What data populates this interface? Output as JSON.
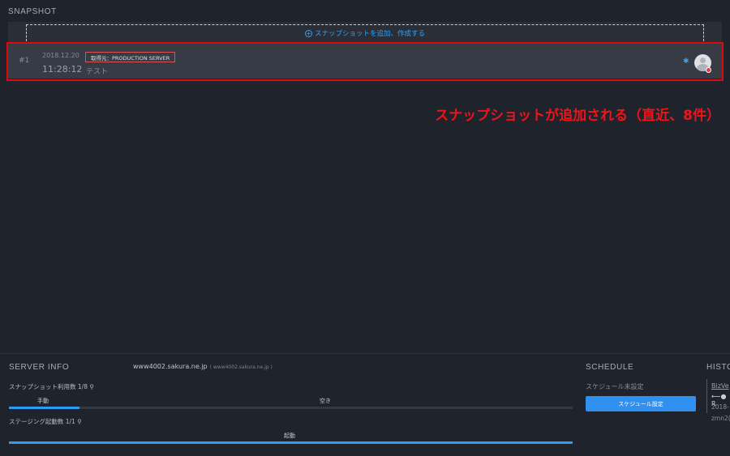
{
  "snapshot": {
    "title": "SNAPSHOT",
    "add_label": "スナップショットを追加、作成する",
    "rows": [
      {
        "number": "#1",
        "date": "2018.12.20",
        "time": "11:28:12",
        "source": "取得元：PRODUCTION SERVER",
        "memo": "テスト"
      }
    ]
  },
  "annotation": "スナップショットが追加される（直近、8件）",
  "server_info": {
    "title": "SERVER INFO",
    "host": "www4002.sakura.ne.jp",
    "host_sub": "( www4002.sakura.ne.jp )",
    "snapshot_usage_label": "スナップショット利用数",
    "snapshot_usage_count": "1/8",
    "manual_label": "手動",
    "free_label": "空き",
    "snapshot_usage_fraction": 0.125,
    "staging_label": "ステージング起動数",
    "staging_count": "1/1",
    "running_label": "起動",
    "staging_fraction": 1.0
  },
  "schedule": {
    "title": "SCHEDULE",
    "status": "スケジュール未設定",
    "button": "スケジュール設定"
  },
  "history": {
    "title": "HISTO",
    "link": "BizVe",
    "arrow": "⟵●  R",
    "date": "2018-",
    "user": "zmn2("
  },
  "colors": {
    "accent": "#2f9cf0",
    "annotation": "#f0131a",
    "highlight_border": "#e2080e"
  }
}
